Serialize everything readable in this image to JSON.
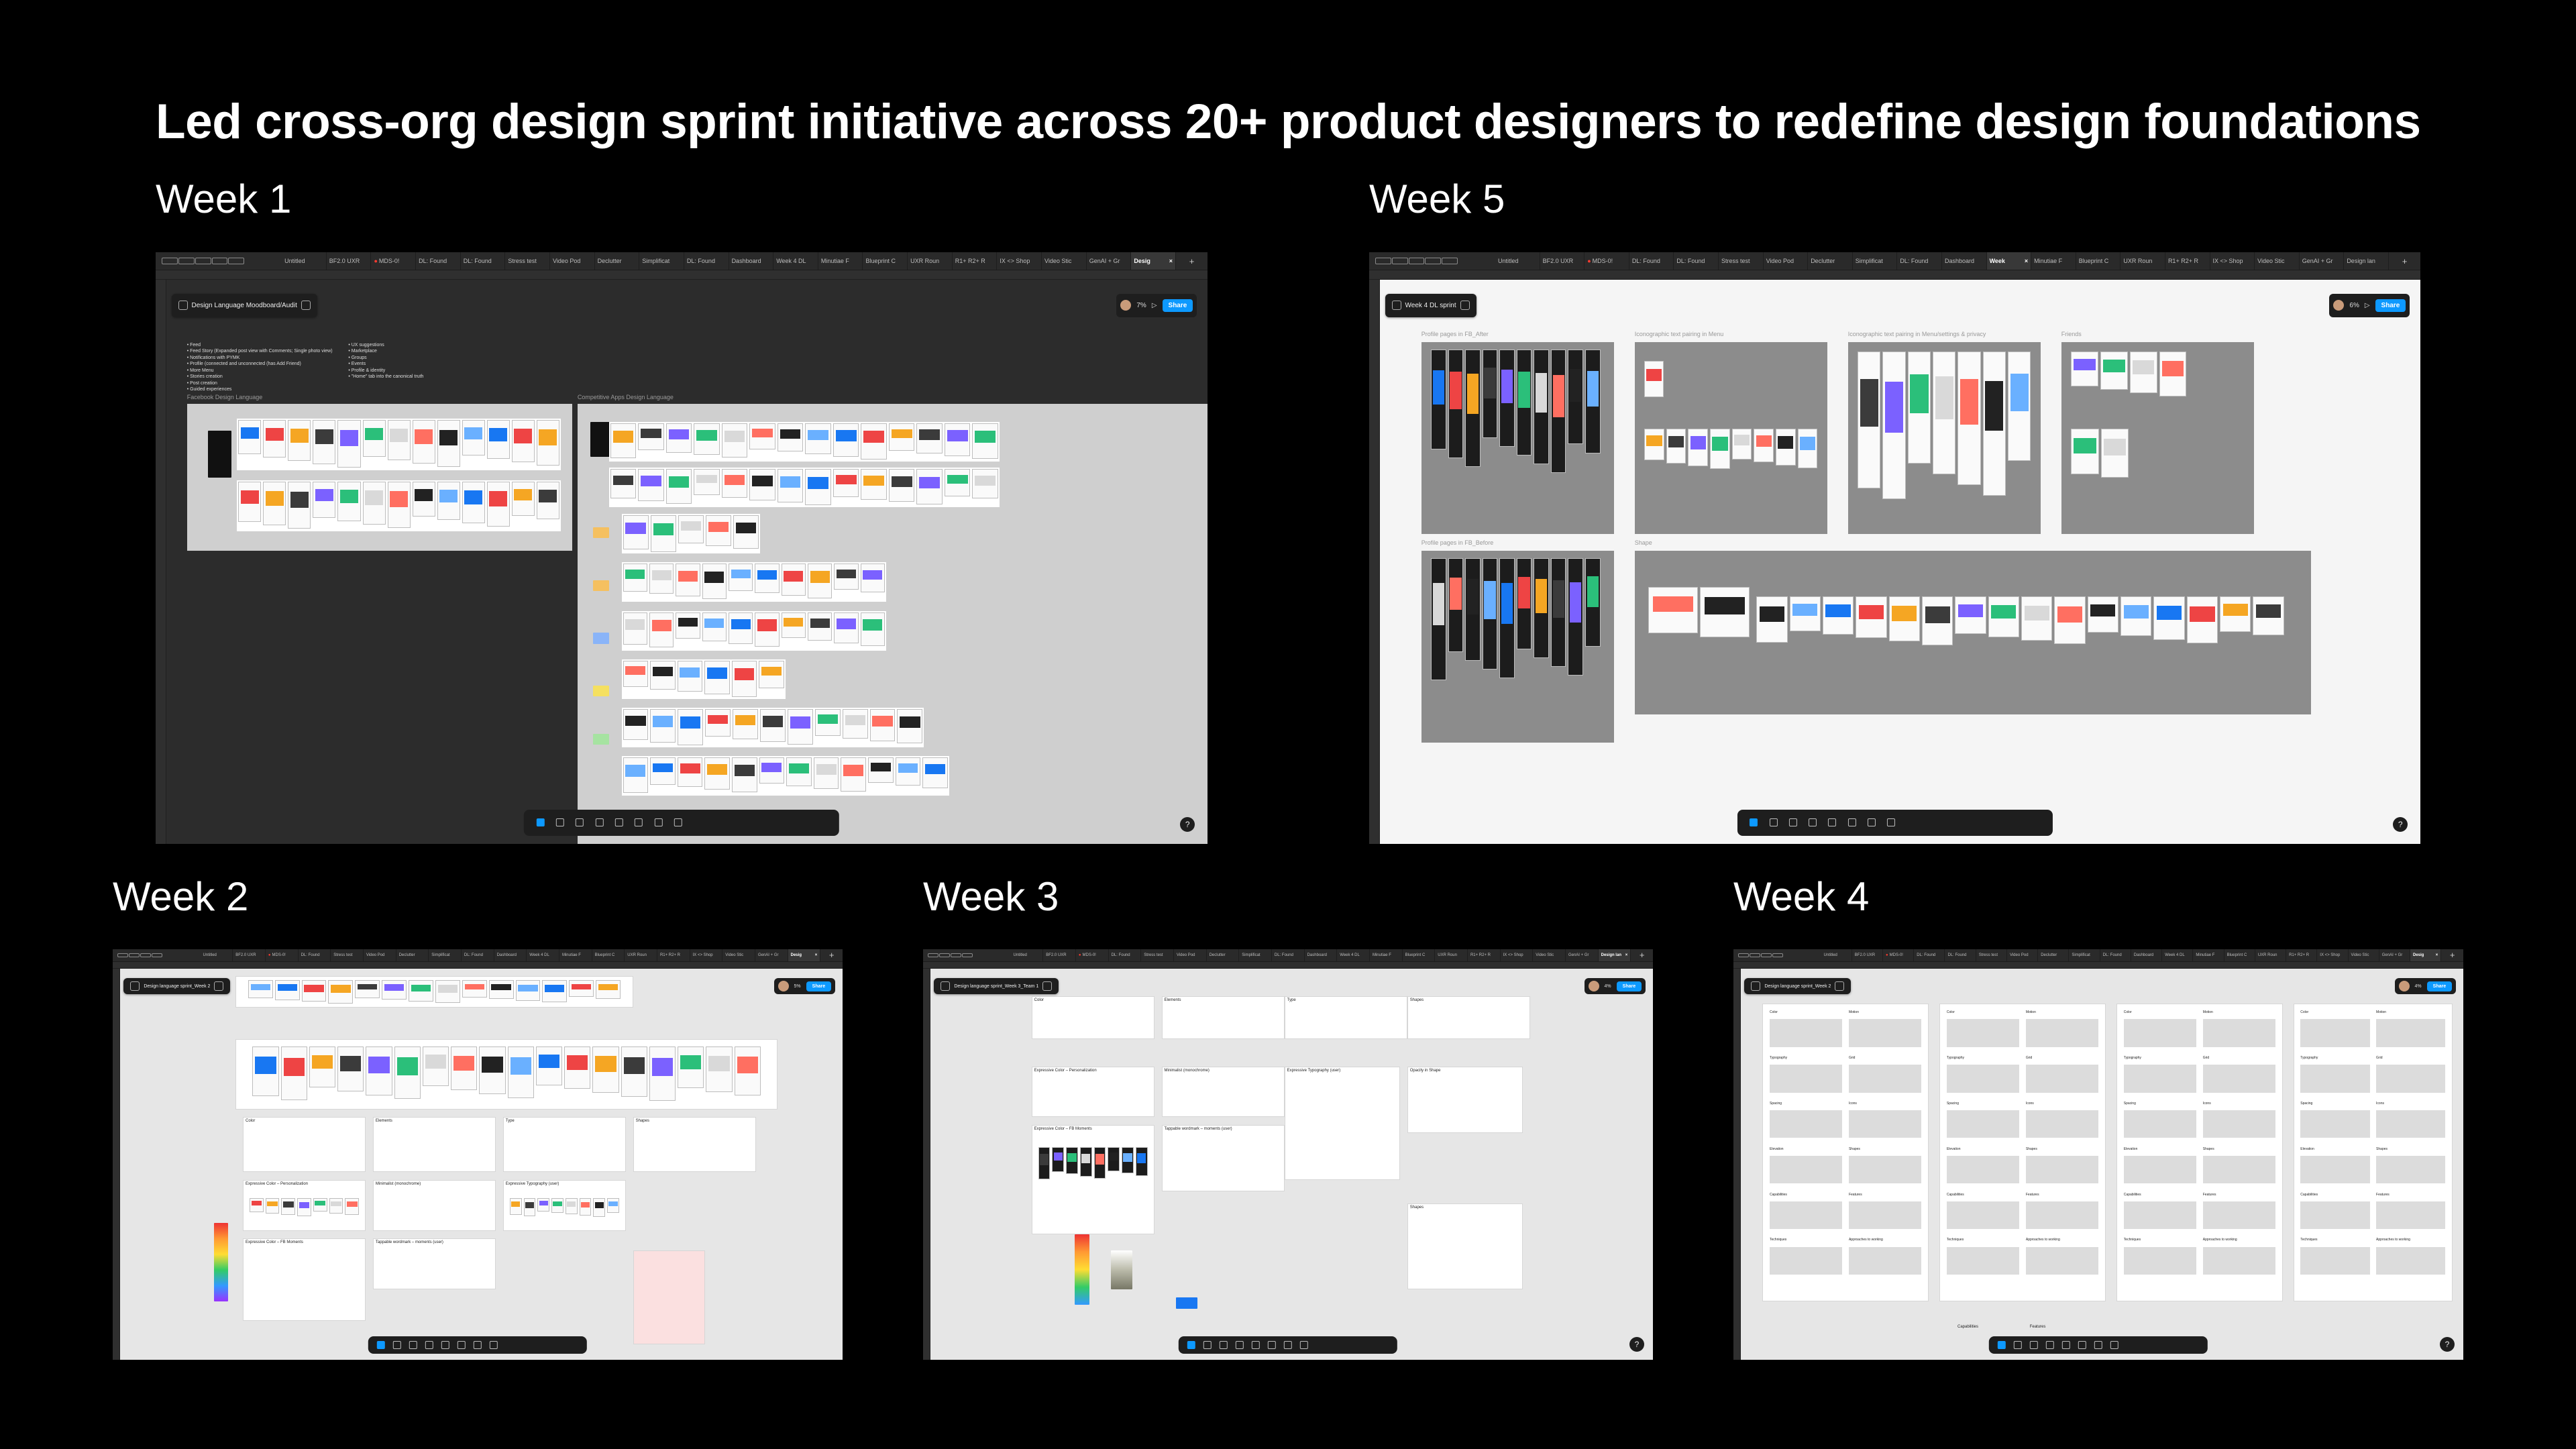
{
  "headline": "Led cross-org design sprint initiative across 20+ product designers to redefine design foundations",
  "colors": {
    "background": "#000000",
    "figma_blue": "#0d99ff",
    "tab_close_red": "#ff3b30"
  },
  "icons": [
    "menu-icon",
    "panel-icon",
    "move-tool-icon",
    "frame-tool-icon",
    "shape-tool-icon",
    "pen-tool-icon",
    "text-tool-icon",
    "comment-tool-icon",
    "actions-icon",
    "dev-mode-icon",
    "help-icon",
    "play-icon"
  ],
  "weeks": {
    "week1": {
      "label": "Week 1",
      "file_title": "Design Language Moodboard/Audit",
      "zoom": "7%",
      "share": "Share",
      "help": "?",
      "tabs": [
        "Untitled",
        "BF2.0 UXR",
        "MDS-0!",
        "DL: Found",
        "DL: Found",
        "Stress test",
        "Video Pod",
        "Declutter",
        "Simplificat",
        "DL: Found",
        "Dashboard",
        "Week 4 DL",
        "Minutiae F",
        "Blueprint C",
        "UXR Roun",
        "R1+ R2+ R",
        "IX <> Shop",
        "Video Stic",
        "GenAI + Gr",
        "Desig"
      ],
      "bullets": [
        "Feed",
        "Feed Story (Expanded post view with Comments; Single photo view)",
        "Notifications with PYMK",
        "Profile (connected and unconnected (has Add Friend)",
        "More Menu",
        "Stories creation",
        "Post creation",
        "Guided experiences"
      ],
      "bullets_right": [
        "UX suggestions",
        "Marketplace",
        "Groups",
        "Events",
        "Profile & identity",
        "\"Home\" tab into the canonical truth"
      ],
      "section_a": "Facebook Design Language",
      "section_b": "Competitive Apps Design Language"
    },
    "week5": {
      "label": "Week 5",
      "file_title": "Week 4 DL sprint",
      "zoom": "6%",
      "share": "Share",
      "help": "?",
      "tabs": [
        "Untitled",
        "BF2.0 UXR",
        "MDS-0!",
        "DL: Found",
        "DL: Found",
        "Stress test",
        "Video Pod",
        "Declutter",
        "Simplificat",
        "DL: Found",
        "Dashboard",
        "Week",
        "Minutiae F",
        "Blueprint C",
        "UXR Roun",
        "R1+ R2+ R",
        "IX <> Shop",
        "Video Stic",
        "GenAI + Gr",
        "Design lan"
      ],
      "sections": [
        "Profile pages in FB_After",
        "Iconographic text pairing in Menu",
        "Iconographic text pairing in Menu/settings & privacy",
        "Friends",
        "Profile pages in FB_Before",
        "Shape"
      ]
    },
    "week2": {
      "label": "Week 2",
      "file_title": "Design language sprint_Week 2",
      "zoom": "5%",
      "share": "Share",
      "tabs": [
        "Untitled",
        "BF2.0 UXR",
        "MDS-0!",
        "DL: Found",
        "Stress test",
        "Video Pod",
        "Declutter",
        "Simplificat",
        "DL: Found",
        "Dashboard",
        "Week 4 DL",
        "Minutiae F",
        "Blueprint C",
        "UXR Roun",
        "R1+ R2+ R",
        "IX <> Shop",
        "Video Stic",
        "GenAI + Gr",
        "Desig"
      ],
      "sections": [
        "Color",
        "Elements",
        "Type",
        "Shapes",
        "Expressive Color – Personalization",
        "Minimalist (monochrome)",
        "Expressive Typography (user)",
        "Expressive Color – FB Moments",
        "Tappable wordmark – moments (user)"
      ]
    },
    "week3": {
      "label": "Week 3",
      "file_title": "Design language sprint_Week 3_Team 1",
      "zoom": "4%",
      "share": "Share",
      "tabs": [
        "Untitled",
        "BF2.0 UXR",
        "MDS-0!",
        "DL: Found",
        "Stress test",
        "Video Pod",
        "Declutter",
        "Simplificat",
        "DL: Found",
        "Dashboard",
        "Week 4 DL",
        "Minutiae F",
        "Blueprint C",
        "UXR Roun",
        "R1+ R2+ R",
        "IX <> Shop",
        "Video Stic",
        "GenAI + Gr",
        "Design lan"
      ],
      "sections": [
        "Color",
        "Elements",
        "Type",
        "Shapes",
        "Expressive Color – Personalization",
        "Minimalist (monochrome)",
        "Expressive Typography (user)",
        "Expressive Color – FB Moments",
        "Tappable wordmark – moments (user)",
        "Opacity in Shape",
        "Shapes"
      ]
    },
    "week4": {
      "label": "Week 4",
      "file_title": "Design language sprint_Week 2",
      "zoom": "4%",
      "share": "Share",
      "tabs": [
        "Untitled",
        "BF2.0 UXR",
        "MDS-0!",
        "DL: Found",
        "DL: Found",
        "Stress test",
        "Video Pod",
        "Declutter",
        "Simplificat",
        "DL: Found",
        "Dashboard",
        "Week 4 DL",
        "Minutiae F",
        "Blueprint C",
        "UXR Roun",
        "R1+ R2+ R",
        "IX <> Shop",
        "Video Stic",
        "GenAI + Gr",
        "Desig"
      ],
      "col_rows": [
        "Color",
        "Motion",
        "Typography",
        "Grid",
        "Spacing",
        "Icons",
        "Elevation",
        "Shapes",
        "Capabilities",
        "Features",
        "Techniques",
        "Approaches to working"
      ],
      "bottom": [
        "Capabilities",
        "Features"
      ]
    }
  }
}
